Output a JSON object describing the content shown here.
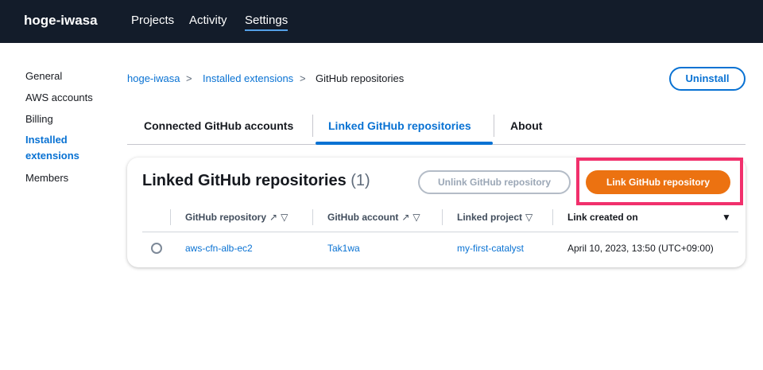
{
  "header": {
    "brand": "hoge-iwasa",
    "nav": [
      "Projects",
      "Activity",
      "Settings"
    ]
  },
  "sidebar": {
    "items": [
      "General",
      "AWS accounts",
      "Billing",
      "Installed",
      "extensions",
      "Members"
    ]
  },
  "breadcrumb": [
    "hoge-iwasa",
    "Installed extensions",
    "GitHub repositories"
  ],
  "uninstall_label": "Uninstall",
  "tabs": [
    "Connected GitHub accounts",
    "Linked GitHub repositories",
    "About"
  ],
  "panel": {
    "title": "Linked GitHub repositories",
    "count": "(1)",
    "unlink_label": "Unlink GitHub repository",
    "link_label": "Link GitHub repository",
    "columns": [
      "GitHub repository",
      "GitHub account",
      "Linked project",
      "Link created on"
    ],
    "rows": [
      {
        "repo": "aws-cfn-alb-ec2",
        "account": "Tak1wa",
        "project": "my-first-catalyst",
        "created": "April 10, 2023, 13:50 (UTC+09:00)"
      }
    ]
  }
}
